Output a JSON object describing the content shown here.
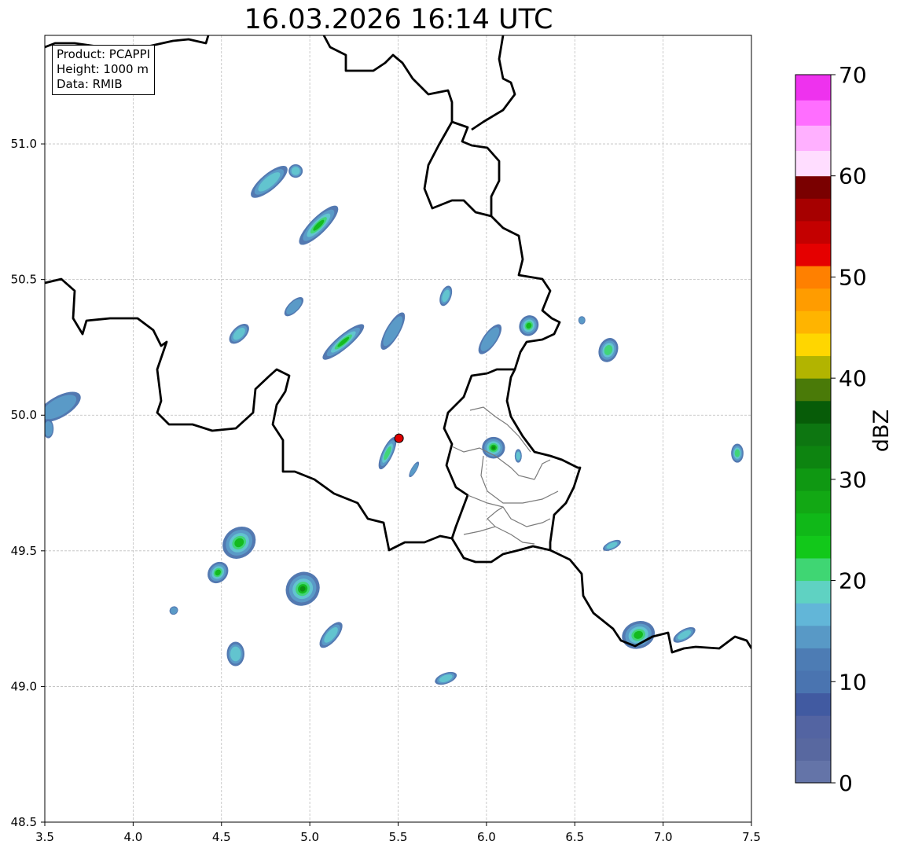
{
  "title": "16.03.2026 16:14 UTC",
  "info": {
    "product": "Product: PCAPPI",
    "height": "Height: 1000 m",
    "data": "Data: RMIB"
  },
  "axes": {
    "x_range": [
      3.5,
      7.5
    ],
    "y_range": [
      48.5,
      51.4
    ],
    "x_ticks": [
      "3.5",
      "4.0",
      "4.5",
      "5.0",
      "5.5",
      "6.0",
      "6.5",
      "7.0",
      "7.5"
    ],
    "y_ticks": [
      "48.5",
      "49.0",
      "49.5",
      "50.0",
      "50.5",
      "51.0"
    ],
    "grid": true
  },
  "radar_site": {
    "lon": 5.505,
    "lat": 49.915,
    "color": "#e00000"
  },
  "colorbar": {
    "label": "dBZ",
    "min": 0,
    "max": 70,
    "step": 2.5,
    "tick_labels": [
      "0",
      "10",
      "20",
      "30",
      "40",
      "50",
      "60",
      "70"
    ],
    "colors": [
      "#6474a8",
      "#5868a0",
      "#5364a2",
      "#415aa1",
      "#4a74b0",
      "#4d7cb4",
      "#5899c6",
      "#62b6d8",
      "#5fd2c2",
      "#3fd673",
      "#12c81a",
      "#10b818",
      "#12a814",
      "#0f9812",
      "#0d8410",
      "#0d7611",
      "#075c08",
      "#4a7a08",
      "#b2b400",
      "#ffd600",
      "#ffb400",
      "#ff9c00",
      "#ff8000",
      "#e50000",
      "#c40000",
      "#a60000",
      "#7a0000",
      "#ffddff",
      "#ffb0ff",
      "#ff6eff",
      "#ee32ee"
    ]
  },
  "echoes": [
    {
      "lon": 3.58,
      "lat": 50.03,
      "w": 0.12,
      "h": 0.18,
      "rot": 60,
      "i": 0.45
    },
    {
      "lon": 3.52,
      "lat": 49.95,
      "w": 0.06,
      "h": 0.07,
      "rot": 0,
      "i": 0.35
    },
    {
      "lon": 4.77,
      "lat": 50.86,
      "w": 0.26,
      "h": 0.06,
      "rot": -40,
      "i": 0.6
    },
    {
      "lon": 4.92,
      "lat": 50.9,
      "w": 0.08,
      "h": 0.05,
      "rot": 0,
      "i": 0.5
    },
    {
      "lon": 5.05,
      "lat": 50.7,
      "w": 0.3,
      "h": 0.06,
      "rot": -45,
      "i": 0.85
    },
    {
      "lon": 4.91,
      "lat": 50.4,
      "w": 0.14,
      "h": 0.04,
      "rot": -45,
      "i": 0.45
    },
    {
      "lon": 4.6,
      "lat": 50.3,
      "w": 0.14,
      "h": 0.05,
      "rot": -45,
      "i": 0.55
    },
    {
      "lon": 5.19,
      "lat": 50.27,
      "w": 0.3,
      "h": 0.05,
      "rot": -40,
      "i": 0.8
    },
    {
      "lon": 5.47,
      "lat": 50.31,
      "w": 0.24,
      "h": 0.05,
      "rot": -60,
      "i": 0.4
    },
    {
      "lon": 5.77,
      "lat": 50.44,
      "w": 0.12,
      "h": 0.04,
      "rot": -70,
      "i": 0.6
    },
    {
      "lon": 6.02,
      "lat": 50.28,
      "w": 0.2,
      "h": 0.05,
      "rot": -55,
      "i": 0.35
    },
    {
      "lon": 6.24,
      "lat": 50.33,
      "w": 0.12,
      "h": 0.07,
      "rot": -60,
      "i": 0.75
    },
    {
      "lon": 6.69,
      "lat": 50.24,
      "w": 0.14,
      "h": 0.07,
      "rot": -70,
      "i": 0.65
    },
    {
      "lon": 6.54,
      "lat": 50.35,
      "w": 0.04,
      "h": 0.03,
      "rot": 0,
      "i": 0.35
    },
    {
      "lon": 5.44,
      "lat": 49.86,
      "w": 0.2,
      "h": 0.04,
      "rot": -65,
      "i": 0.7
    },
    {
      "lon": 5.59,
      "lat": 49.8,
      "w": 0.1,
      "h": 0.02,
      "rot": -60,
      "i": 0.4
    },
    {
      "lon": 6.04,
      "lat": 49.88,
      "w": 0.13,
      "h": 0.08,
      "rot": 0,
      "i": 0.9
    },
    {
      "lon": 6.18,
      "lat": 49.85,
      "w": 0.04,
      "h": 0.05,
      "rot": 0,
      "i": 0.5
    },
    {
      "lon": 4.6,
      "lat": 49.53,
      "w": 0.2,
      "h": 0.11,
      "rot": -40,
      "i": 0.85
    },
    {
      "lon": 4.48,
      "lat": 49.42,
      "w": 0.13,
      "h": 0.07,
      "rot": -50,
      "i": 0.75
    },
    {
      "lon": 4.96,
      "lat": 49.36,
      "w": 0.2,
      "h": 0.12,
      "rot": -45,
      "i": 0.95
    },
    {
      "lon": 5.12,
      "lat": 49.19,
      "w": 0.18,
      "h": 0.05,
      "rot": -50,
      "i": 0.5
    },
    {
      "lon": 4.58,
      "lat": 49.12,
      "w": 0.1,
      "h": 0.09,
      "rot": 0,
      "i": 0.6
    },
    {
      "lon": 4.23,
      "lat": 49.28,
      "w": 0.05,
      "h": 0.03,
      "rot": -40,
      "i": 0.4
    },
    {
      "lon": 5.77,
      "lat": 49.03,
      "w": 0.13,
      "h": 0.04,
      "rot": -20,
      "i": 0.55
    },
    {
      "lon": 6.71,
      "lat": 49.52,
      "w": 0.11,
      "h": 0.03,
      "rot": -25,
      "i": 0.55
    },
    {
      "lon": 6.86,
      "lat": 49.19,
      "w": 0.19,
      "h": 0.1,
      "rot": -20,
      "i": 0.85
    },
    {
      "lon": 7.12,
      "lat": 49.19,
      "w": 0.14,
      "h": 0.04,
      "rot": -30,
      "i": 0.5
    },
    {
      "lon": 7.42,
      "lat": 49.86,
      "w": 0.07,
      "h": 0.07,
      "rot": 0,
      "i": 0.7
    }
  ]
}
